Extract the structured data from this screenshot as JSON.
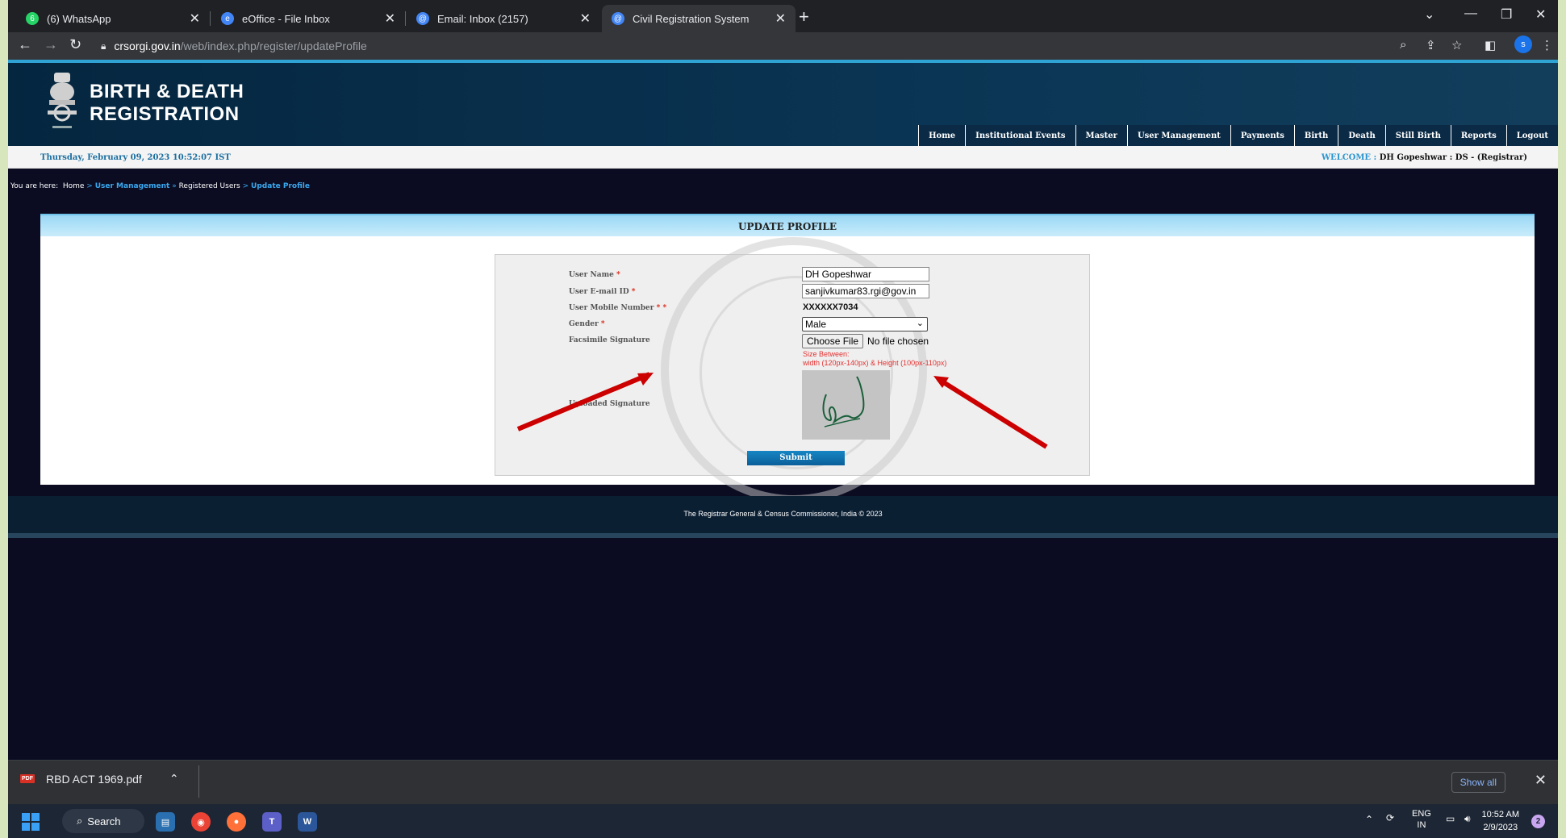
{
  "browser": {
    "tabs": [
      {
        "title": "(6) WhatsApp",
        "favicon": "whatsapp-icon",
        "color": "#25d366"
      },
      {
        "title": "eOffice - File Inbox",
        "favicon": "eoffice-icon",
        "color": "#4285f4"
      },
      {
        "title": "Email: Inbox (2157)",
        "favicon": "email-icon",
        "color": "#4285f4"
      },
      {
        "title": "Civil Registration System",
        "favicon": "crs-icon",
        "color": "#4285f4",
        "active": true
      }
    ],
    "url_host": "crsorgi.gov.in",
    "url_path": "/web/index.php/register/updateProfile",
    "profile_initial": "s"
  },
  "site": {
    "title_line1": "BIRTH & DEATH",
    "title_line2": "REGISTRATION",
    "nav": [
      "Home",
      "Institutional Events",
      "Master",
      "User Management",
      "Payments",
      "Birth",
      "Death",
      "Still Birth",
      "Reports",
      "Logout"
    ],
    "date": "Thursday, February 09, 2023 10:52:07 IST",
    "welcome_label": "WELCOME :",
    "welcome_user": "DH Gopeshwar : DS -  (Registrar)"
  },
  "breadcrumb": {
    "prefix": "You are here:",
    "home": "Home",
    "sep": ">",
    "user_management": "User Management",
    "sep2": "»",
    "registered_users": "Registered Users",
    "sep3": ">",
    "current": "Update Profile"
  },
  "form": {
    "heading": "UPDATE PROFILE",
    "labels": {
      "user_name": "User Name",
      "email": "User E-mail ID",
      "mobile": "User Mobile Number",
      "gender": "Gender",
      "facsimile": "Facsimile Signature",
      "uploaded": "Uploaded Signature"
    },
    "required_mark": "*",
    "mobile_required_mark": "* *",
    "values": {
      "user_name": "DH Gopeshwar",
      "email": "sanjivkumar83.rgi@gov.in",
      "mobile": "XXXXXX7034",
      "gender": "Male"
    },
    "choose_file": "Choose File",
    "no_file": "No file chosen",
    "hint_line1": "Size Between:",
    "hint_line2": "width (120px-140px) & Height (100px-110px)",
    "submit": "Submit"
  },
  "footer": {
    "text": "The Registrar General & Census Commissioner, India © 2023"
  },
  "downloads": {
    "file": "RBD ACT 1969.pdf",
    "show_all": "Show all"
  },
  "taskbar": {
    "search": "Search",
    "lang1": "ENG",
    "lang2": "IN",
    "time": "10:52 AM",
    "date": "2/9/2023",
    "notifications": "2"
  }
}
